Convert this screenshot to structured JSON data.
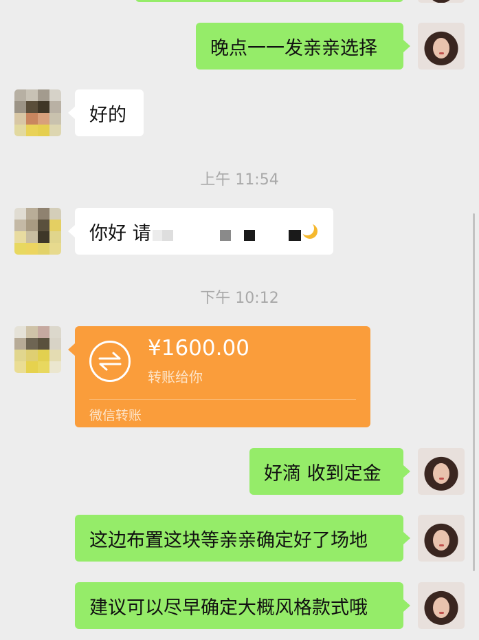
{
  "messages": {
    "m1": "晚点一一发亲亲选择",
    "m2": "好的",
    "m3": "你好 请",
    "m5": "好滴 收到定金",
    "m6": "这边布置这块等亲亲确定好了场地",
    "m7": "建议可以尽早确定大概风格款式哦"
  },
  "timestamps": {
    "t1": "上午 11:54",
    "t2": "下午 10:12"
  },
  "transfer": {
    "amount": "¥1600.00",
    "note": "转账给你",
    "brand": "微信转账"
  },
  "icons": {
    "transfer": "transfer-arrows-icon",
    "emoji": "moon-emoji-icon"
  },
  "colors": {
    "outgoing_bubble": "#95ec69",
    "incoming_bubble": "#ffffff",
    "transfer_bubble": "#fa9d3b",
    "background": "#ededed",
    "timestamp_text": "#a8a8a8"
  }
}
